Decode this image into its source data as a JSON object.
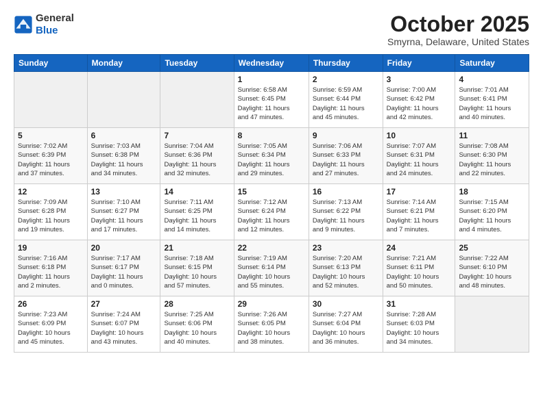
{
  "logo": {
    "line1": "General",
    "line2": "Blue"
  },
  "title": "October 2025",
  "location": "Smyrna, Delaware, United States",
  "headers": [
    "Sunday",
    "Monday",
    "Tuesday",
    "Wednesday",
    "Thursday",
    "Friday",
    "Saturday"
  ],
  "weeks": [
    [
      {
        "day": "",
        "info": ""
      },
      {
        "day": "",
        "info": ""
      },
      {
        "day": "",
        "info": ""
      },
      {
        "day": "1",
        "info": "Sunrise: 6:58 AM\nSunset: 6:45 PM\nDaylight: 11 hours\nand 47 minutes."
      },
      {
        "day": "2",
        "info": "Sunrise: 6:59 AM\nSunset: 6:44 PM\nDaylight: 11 hours\nand 45 minutes."
      },
      {
        "day": "3",
        "info": "Sunrise: 7:00 AM\nSunset: 6:42 PM\nDaylight: 11 hours\nand 42 minutes."
      },
      {
        "day": "4",
        "info": "Sunrise: 7:01 AM\nSunset: 6:41 PM\nDaylight: 11 hours\nand 40 minutes."
      }
    ],
    [
      {
        "day": "5",
        "info": "Sunrise: 7:02 AM\nSunset: 6:39 PM\nDaylight: 11 hours\nand 37 minutes."
      },
      {
        "day": "6",
        "info": "Sunrise: 7:03 AM\nSunset: 6:38 PM\nDaylight: 11 hours\nand 34 minutes."
      },
      {
        "day": "7",
        "info": "Sunrise: 7:04 AM\nSunset: 6:36 PM\nDaylight: 11 hours\nand 32 minutes."
      },
      {
        "day": "8",
        "info": "Sunrise: 7:05 AM\nSunset: 6:34 PM\nDaylight: 11 hours\nand 29 minutes."
      },
      {
        "day": "9",
        "info": "Sunrise: 7:06 AM\nSunset: 6:33 PM\nDaylight: 11 hours\nand 27 minutes."
      },
      {
        "day": "10",
        "info": "Sunrise: 7:07 AM\nSunset: 6:31 PM\nDaylight: 11 hours\nand 24 minutes."
      },
      {
        "day": "11",
        "info": "Sunrise: 7:08 AM\nSunset: 6:30 PM\nDaylight: 11 hours\nand 22 minutes."
      }
    ],
    [
      {
        "day": "12",
        "info": "Sunrise: 7:09 AM\nSunset: 6:28 PM\nDaylight: 11 hours\nand 19 minutes."
      },
      {
        "day": "13",
        "info": "Sunrise: 7:10 AM\nSunset: 6:27 PM\nDaylight: 11 hours\nand 17 minutes."
      },
      {
        "day": "14",
        "info": "Sunrise: 7:11 AM\nSunset: 6:25 PM\nDaylight: 11 hours\nand 14 minutes."
      },
      {
        "day": "15",
        "info": "Sunrise: 7:12 AM\nSunset: 6:24 PM\nDaylight: 11 hours\nand 12 minutes."
      },
      {
        "day": "16",
        "info": "Sunrise: 7:13 AM\nSunset: 6:22 PM\nDaylight: 11 hours\nand 9 minutes."
      },
      {
        "day": "17",
        "info": "Sunrise: 7:14 AM\nSunset: 6:21 PM\nDaylight: 11 hours\nand 7 minutes."
      },
      {
        "day": "18",
        "info": "Sunrise: 7:15 AM\nSunset: 6:20 PM\nDaylight: 11 hours\nand 4 minutes."
      }
    ],
    [
      {
        "day": "19",
        "info": "Sunrise: 7:16 AM\nSunset: 6:18 PM\nDaylight: 11 hours\nand 2 minutes."
      },
      {
        "day": "20",
        "info": "Sunrise: 7:17 AM\nSunset: 6:17 PM\nDaylight: 11 hours\nand 0 minutes."
      },
      {
        "day": "21",
        "info": "Sunrise: 7:18 AM\nSunset: 6:15 PM\nDaylight: 10 hours\nand 57 minutes."
      },
      {
        "day": "22",
        "info": "Sunrise: 7:19 AM\nSunset: 6:14 PM\nDaylight: 10 hours\nand 55 minutes."
      },
      {
        "day": "23",
        "info": "Sunrise: 7:20 AM\nSunset: 6:13 PM\nDaylight: 10 hours\nand 52 minutes."
      },
      {
        "day": "24",
        "info": "Sunrise: 7:21 AM\nSunset: 6:11 PM\nDaylight: 10 hours\nand 50 minutes."
      },
      {
        "day": "25",
        "info": "Sunrise: 7:22 AM\nSunset: 6:10 PM\nDaylight: 10 hours\nand 48 minutes."
      }
    ],
    [
      {
        "day": "26",
        "info": "Sunrise: 7:23 AM\nSunset: 6:09 PM\nDaylight: 10 hours\nand 45 minutes."
      },
      {
        "day": "27",
        "info": "Sunrise: 7:24 AM\nSunset: 6:07 PM\nDaylight: 10 hours\nand 43 minutes."
      },
      {
        "day": "28",
        "info": "Sunrise: 7:25 AM\nSunset: 6:06 PM\nDaylight: 10 hours\nand 40 minutes."
      },
      {
        "day": "29",
        "info": "Sunrise: 7:26 AM\nSunset: 6:05 PM\nDaylight: 10 hours\nand 38 minutes."
      },
      {
        "day": "30",
        "info": "Sunrise: 7:27 AM\nSunset: 6:04 PM\nDaylight: 10 hours\nand 36 minutes."
      },
      {
        "day": "31",
        "info": "Sunrise: 7:28 AM\nSunset: 6:03 PM\nDaylight: 10 hours\nand 34 minutes."
      },
      {
        "day": "",
        "info": ""
      }
    ]
  ]
}
